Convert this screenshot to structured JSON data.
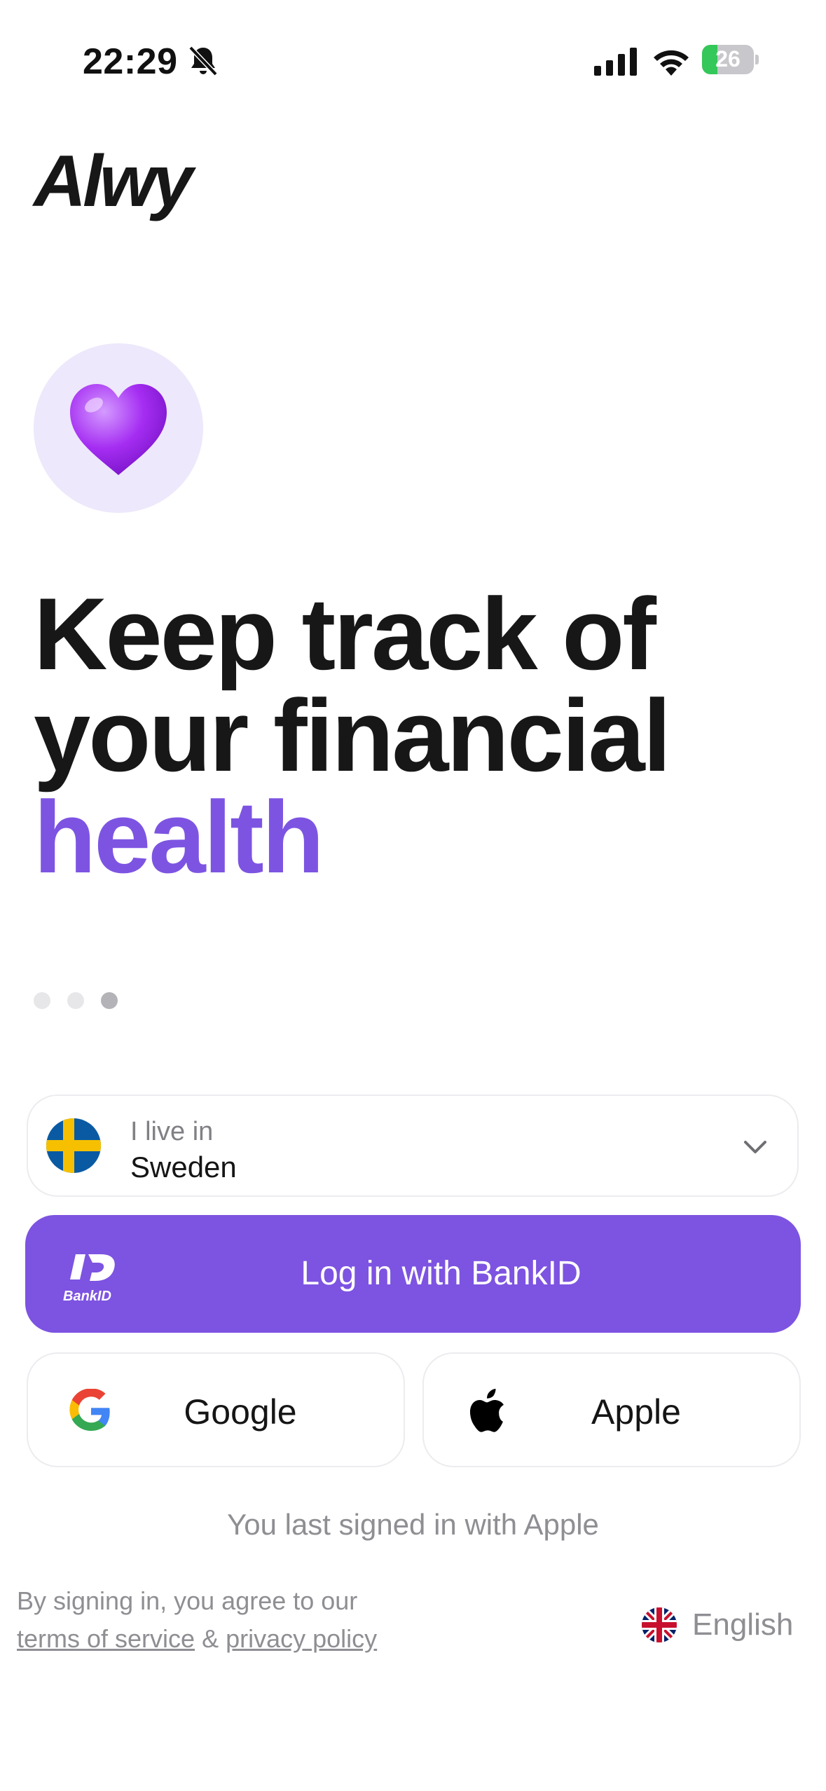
{
  "status_bar": {
    "time": "22:29",
    "battery": "26"
  },
  "brand": {
    "logo_text": "Alwy"
  },
  "hero": {
    "icon": "purple-heart",
    "headline_line1": "Keep track of",
    "headline_line2": "your financial",
    "headline_accent": "health"
  },
  "pager": {
    "total": 3,
    "active_index": 3
  },
  "country_selector": {
    "label": "I live in",
    "value": "Sweden"
  },
  "login": {
    "bankid_label": "Log in with BankID",
    "bankid_logo_text": "BankID",
    "google_label": "Google",
    "apple_label": "Apple",
    "last_signed_in": "You last signed in with Apple"
  },
  "legal": {
    "prefix": "By signing in, you agree to our",
    "terms_link": "terms of service",
    "separator": "&",
    "privacy_link": "privacy policy"
  },
  "language": {
    "value": "English"
  },
  "colors": {
    "accent": "#7d54e2",
    "button": "#7d53e1",
    "muted": "#8e8e93"
  }
}
